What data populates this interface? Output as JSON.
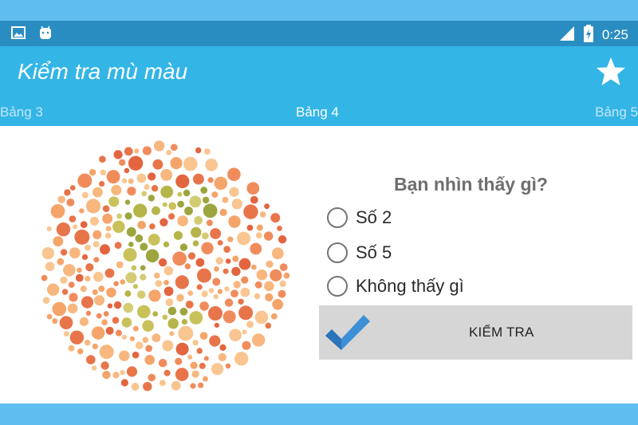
{
  "status_bar": {
    "time": "0:25",
    "icons": [
      "image-icon",
      "android-icon",
      "signal-icon",
      "battery-charging-icon"
    ]
  },
  "app_bar": {
    "title": "Kiểm tra mù màu",
    "action_icon": "star-icon"
  },
  "tabs": {
    "previous": "Bảng 3",
    "current": "Bảng 4",
    "next": "Bảng 5"
  },
  "quiz": {
    "question": "Bạn nhìn thấy gì?",
    "options": [
      {
        "label": "Số 2",
        "selected": false
      },
      {
        "label": "Số 5",
        "selected": false
      },
      {
        "label": "Không thấy gì",
        "selected": false
      }
    ],
    "check_button": {
      "label": "KIỂM TRA",
      "icon": "checkmark-icon"
    }
  },
  "colors": {
    "status_bar": "#2a8dc2",
    "app_bar": "#33b5e6",
    "dot_background": [
      "#e8744a",
      "#f08c5c",
      "#f5a46a",
      "#f7b77e",
      "#e3653f",
      "#f9c691"
    ],
    "dot_figure": [
      "#b5b54a",
      "#c9c25a",
      "#9da63e",
      "#d3cc73"
    ]
  }
}
